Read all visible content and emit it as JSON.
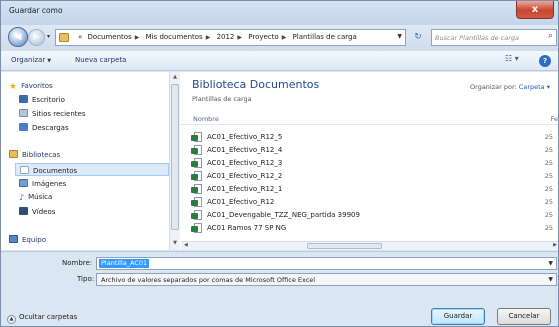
{
  "window": {
    "title": "Guardar como",
    "close_label": "x"
  },
  "address": {
    "back_glyph": "◀",
    "forward_glyph": "▶",
    "breadcrumbs": [
      "«",
      "Documentos",
      "Mis documentos",
      "2012",
      "Proyecto",
      "Plantillas de carga"
    ],
    "refresh_glyph": "↻",
    "search_placeholder": "Buscar Plantillas de carga"
  },
  "toolbar": {
    "organize": "Organizar",
    "new_folder": "Nueva carpeta"
  },
  "sidebar": {
    "favorites": {
      "label": "Favoritos",
      "items": [
        "Escritorio",
        "Sitios recientes",
        "Descargas"
      ]
    },
    "libraries": {
      "label": "Bibliotecas",
      "items": [
        "Documentos",
        "Imágenes",
        "Música",
        "Vídeos"
      ]
    },
    "computer": {
      "label": "Equipo"
    }
  },
  "main": {
    "library_title": "Biblioteca Documentos",
    "library_subtitle": "Plantillas de carga",
    "arrange_label": "Organizar por:",
    "arrange_value": "Carpeta",
    "columns": {
      "name": "Nombre",
      "date": "Fe"
    },
    "files": [
      {
        "name": "AC01_Efectivo_R12_5",
        "date": "25"
      },
      {
        "name": "AC01_Efectivo_R12_4",
        "date": "25"
      },
      {
        "name": "AC01_Efectivo_R12_3",
        "date": "25"
      },
      {
        "name": "AC01_Efectivo_R12_2",
        "date": "25"
      },
      {
        "name": "AC01_Efectivo_R12_1",
        "date": "25"
      },
      {
        "name": "AC01_Efectivo_R12",
        "date": "25"
      },
      {
        "name": "AC01_Devengable_TZZ_NEG_partida 39909",
        "date": "25"
      },
      {
        "name": "AC01 Ramos 77 SP NG",
        "date": "25"
      }
    ]
  },
  "form": {
    "name_label": "Nombre:",
    "name_value": "Plantilla_AC01",
    "type_label": "Tipo:",
    "type_value": "Archivo de valores separados por comas de Microsoft Office Excel",
    "hide_folders": "Ocultar carpetas",
    "save": "Guardar",
    "cancel": "Cancelar"
  },
  "colors": {
    "accent": "#1f4a8a",
    "selection": "#3399ff",
    "frame": "#dbe6f3"
  }
}
